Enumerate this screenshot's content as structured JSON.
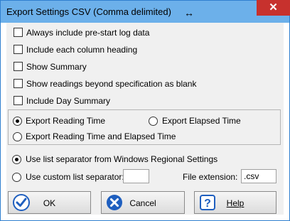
{
  "window": {
    "title": "Export Settings CSV (Comma delimited)",
    "close_symbol": "✕",
    "resize_symbol": "↔"
  },
  "options": {
    "always_prestart": "Always include pre-start log data",
    "include_headings": "Include each column heading",
    "show_summary": "Show Summary",
    "beyond_spec_blank": "Show readings beyond specification as blank",
    "include_day_summary": "Include Day Summary"
  },
  "export_time": {
    "reading_time": "Export Reading Time",
    "elapsed_time": "Export Elapsed Time",
    "both": "Export Reading Time and Elapsed Time",
    "selected": "reading_time"
  },
  "separator": {
    "use_regional": "Use list separator from Windows Regional Settings",
    "use_custom": "Use custom list separator:",
    "custom_value": "",
    "selected": "use_regional"
  },
  "file_extension": {
    "label": "File extension:",
    "value": ".csv"
  },
  "buttons": {
    "ok": "OK",
    "cancel": "Cancel",
    "help": "Help"
  },
  "colors": {
    "titlebar": "#6cb0ea",
    "close": "#c7312d",
    "icon_blue": "#1f5fbf"
  }
}
